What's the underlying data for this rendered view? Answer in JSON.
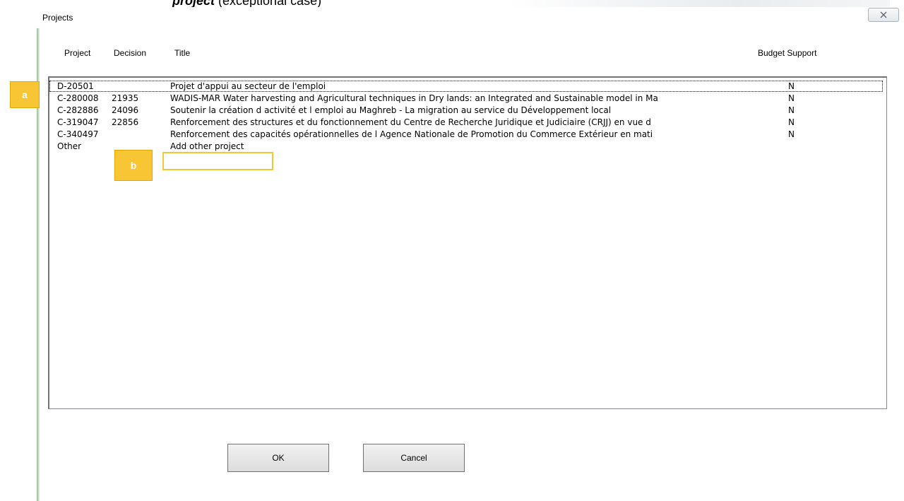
{
  "background": {
    "caption_bold": "project",
    "caption_rest": " (exceptional case)"
  },
  "dialog": {
    "title": "Projects",
    "close_icon": "close-x-icon",
    "columns": {
      "project": "Project",
      "decision": "Decision",
      "title": "Title",
      "budget_support": "Budget Support"
    },
    "rows": [
      {
        "project": "D-20501",
        "decision": "",
        "title": "Projet d'appui au secteur de l'emploi",
        "budget_support": "N"
      },
      {
        "project": "C-280008",
        "decision": "21935",
        "title": "WADIS-MAR Water harvesting and Agricultural techniques in Dry lands: an Integrated and Sustainable model in Ma",
        "budget_support": "N"
      },
      {
        "project": "C-282886",
        "decision": "24096",
        "title": "Soutenir la création d  activité et l   emploi au Maghreb - La migration au service du Développement local",
        "budget_support": "N"
      },
      {
        "project": "C-319047",
        "decision": "22856",
        "title": "Renforcement des structures et du fonctionnement du Centre de Recherche Juridique et Judiciaire (CRJJ) en vue d",
        "budget_support": "N"
      },
      {
        "project": "C-340497",
        "decision": "",
        "title": "Renforcement des capacités opérationnelles de l   Agence Nationale de Promotion du Commerce Extérieur en mati",
        "budget_support": "N"
      },
      {
        "project": "Other",
        "decision": "",
        "title": "Add other project",
        "budget_support": ""
      }
    ],
    "ok_label": "OK",
    "cancel_label": "Cancel"
  },
  "annotations": {
    "a": "a",
    "b": "b",
    "color": "#f8c534"
  }
}
